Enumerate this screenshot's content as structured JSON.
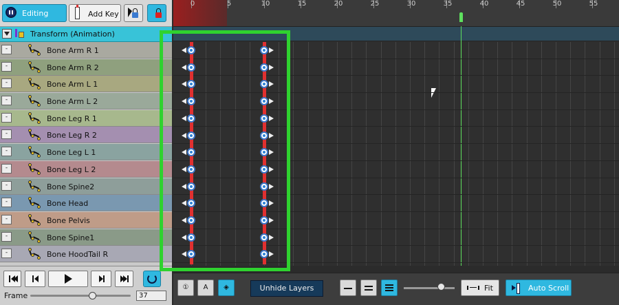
{
  "toolbar": {
    "editing_label": "Editing",
    "add_key_label": "Add Key"
  },
  "group": {
    "label": "Transform (Animation)"
  },
  "layers": [
    {
      "label": "Bone Arm R 1",
      "color": "#a9a9a0"
    },
    {
      "label": "Bone Arm R 2",
      "color": "#8fa07e"
    },
    {
      "label": "Bone Arm L 1",
      "color": "#a8a880"
    },
    {
      "label": "Bone Arm L 2",
      "color": "#9aa99a"
    },
    {
      "label": "Bone Leg R 1",
      "color": "#a7b88d"
    },
    {
      "label": "Bone Leg R 2",
      "color": "#a48fb0"
    },
    {
      "label": "Bone Leg L 1",
      "color": "#8aa3a0"
    },
    {
      "label": "Bone Leg L 2",
      "color": "#b48a8e"
    },
    {
      "label": "Bone Spine2",
      "color": "#8e9e9a"
    },
    {
      "label": "Bone Head",
      "color": "#7a98b0"
    },
    {
      "label": "Bone Pelvis",
      "color": "#bf9c88"
    },
    {
      "label": "Bone Spine1",
      "color": "#8a9a88"
    },
    {
      "label": "Bone HoodTail R",
      "color": "#a8a8b4"
    }
  ],
  "ruler": {
    "ticks": [
      "0",
      "5",
      "10",
      "15",
      "20",
      "25",
      "30",
      "35",
      "40",
      "45",
      "50",
      "55"
    ]
  },
  "keyframes": [
    0,
    10
  ],
  "current_frame": 37,
  "transport": {
    "frame_label": "Frame",
    "frame_value": "37"
  },
  "bottom": {
    "unhide_label": "Unhide Layers",
    "fit_label": "Fit",
    "auto_scroll_label": "Auto Scroll"
  },
  "colors": {
    "accent": "#2fb8e0",
    "highlight": "#2fd22f",
    "playhead": "#5ee05e",
    "key": "#e03030"
  }
}
